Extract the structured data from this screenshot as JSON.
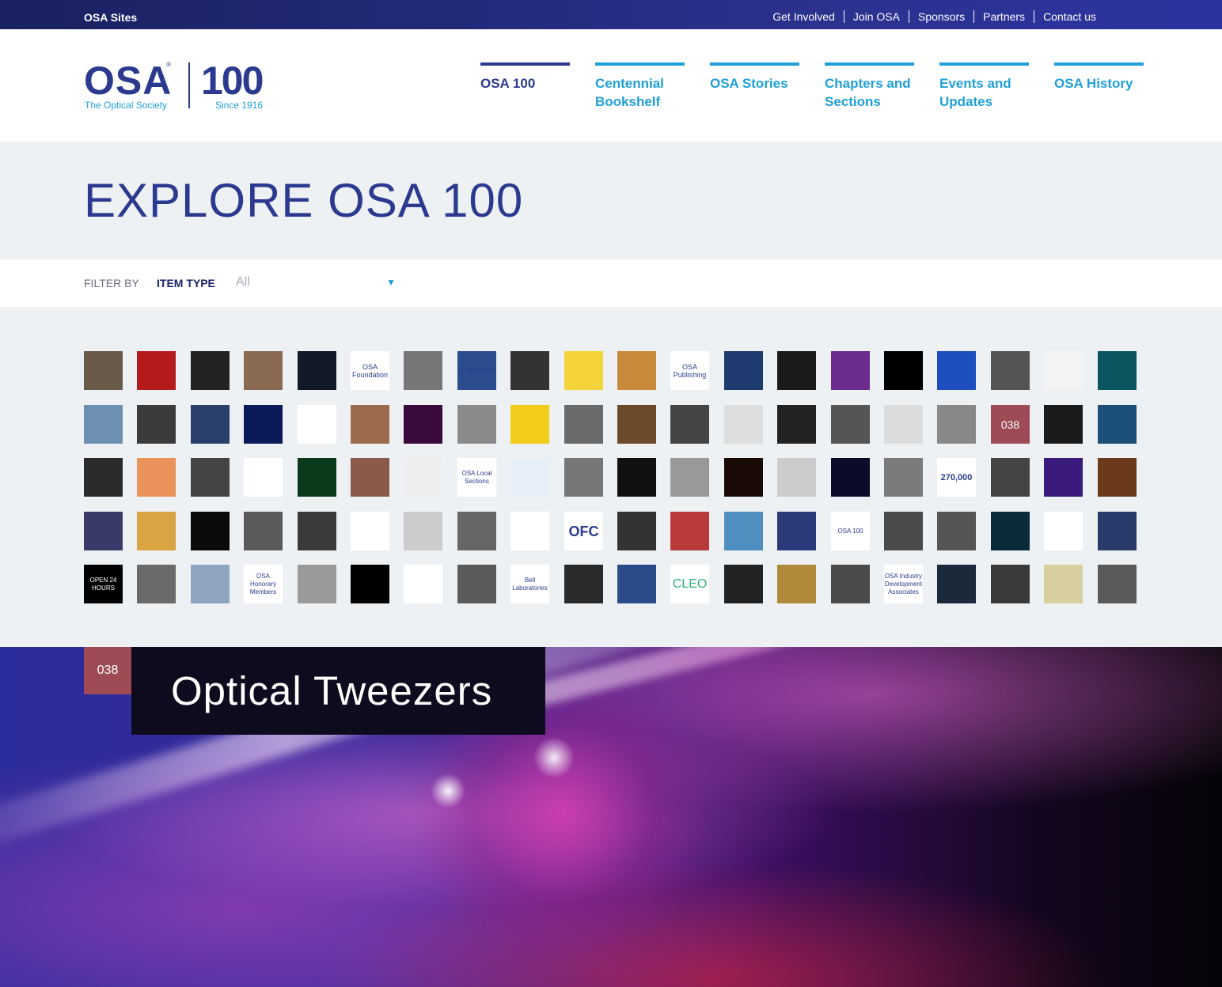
{
  "topbar": {
    "sites": "OSA Sites",
    "links": [
      "Get Involved",
      "Join OSA",
      "Sponsors",
      "Partners",
      "Contact us"
    ]
  },
  "logo": {
    "osa": "OSA",
    "osa_sub": "The Optical Society",
    "hundred": "100",
    "since": "Since 1916",
    "reg": "®"
  },
  "nav": {
    "items": [
      "OSA 100",
      "Centennial Bookshelf",
      "OSA Stories",
      "Chapters and Sections",
      "Events and Updates",
      "OSA History"
    ],
    "active": "OSA 100"
  },
  "page": {
    "title": "EXPLORE OSA 100"
  },
  "filter": {
    "label": "FILTER BY",
    "type": "ITEM TYPE",
    "value": "All",
    "arrow": "▼"
  },
  "tiles": [
    [
      "#6a5a4a",
      ""
    ],
    [
      "#b31b1b",
      ""
    ],
    [
      "#222222",
      ""
    ],
    [
      "#8a6a52",
      ""
    ],
    [
      "#111827",
      ""
    ],
    [
      "#ffffff",
      "OSA Foundation"
    ],
    [
      "#777777",
      ""
    ],
    [
      "#2b4d8f",
      "LASERFEST"
    ],
    [
      "#333333",
      ""
    ],
    [
      "#f4d33b",
      ""
    ],
    [
      "#c88a3a",
      ""
    ],
    [
      "#ffffff",
      "OSA Publishing"
    ],
    [
      "#1e3a6e",
      ""
    ],
    [
      "#1a1a1a",
      ""
    ],
    [
      "#6a2c8f",
      ""
    ],
    [
      "#000000",
      ""
    ],
    [
      "#1d4fbf",
      ""
    ],
    [
      "#555555",
      ""
    ],
    [
      "#f4f4f4",
      ""
    ],
    [
      "#0a5560",
      ""
    ],
    [
      "#6d8fb2",
      ""
    ],
    [
      "#3b3b3b",
      ""
    ],
    [
      "#2a3f6b",
      ""
    ],
    [
      "#0c1a5a",
      ""
    ],
    [
      "#ffffff",
      ""
    ],
    [
      "#9c6a4d",
      ""
    ],
    [
      "#3a0a3a",
      ""
    ],
    [
      "#8a8a8a",
      ""
    ],
    [
      "#f1cc1a",
      ""
    ],
    [
      "#6a6a6a",
      ""
    ],
    [
      "#6a4a2a",
      ""
    ],
    [
      "#444444",
      ""
    ],
    [
      "#dddddd",
      ""
    ],
    [
      "#222222",
      ""
    ],
    [
      "#555555",
      ""
    ],
    [
      "#dcdcdc",
      ""
    ],
    [
      "#888888",
      ""
    ],
    [
      "#9e4b56",
      "038"
    ],
    [
      "#1a1a1a",
      ""
    ],
    [
      "#1b4f7a",
      ""
    ],
    [
      "#2a2a2a",
      ""
    ],
    [
      "#e9925a",
      ""
    ],
    [
      "#444444",
      ""
    ],
    [
      "#ffffff",
      ""
    ],
    [
      "#0a3a1a",
      ""
    ],
    [
      "#8a5a4a",
      ""
    ],
    [
      "#eeeeee",
      ""
    ],
    [
      "#ffffff",
      "OSA Local Sections"
    ],
    [
      "#e6eef7",
      ""
    ],
    [
      "#777777",
      ""
    ],
    [
      "#111111",
      ""
    ],
    [
      "#999999",
      ""
    ],
    [
      "#1a0a05",
      ""
    ],
    [
      "#cccccc",
      ""
    ],
    [
      "#0c0c2a",
      ""
    ],
    [
      "#7a7a7a",
      ""
    ],
    [
      "#ffffff",
      "270,000"
    ],
    [
      "#444444",
      ""
    ],
    [
      "#3a1a7a",
      ""
    ],
    [
      "#6a3a1a",
      ""
    ],
    [
      "#3a3a6a",
      ""
    ],
    [
      "#d9a441",
      ""
    ],
    [
      "#0a0a0a",
      ""
    ],
    [
      "#5a5a5a",
      ""
    ],
    [
      "#3a3a3a",
      ""
    ],
    [
      "#ffffff",
      ""
    ],
    [
      "#cccccc",
      ""
    ],
    [
      "#666666",
      ""
    ],
    [
      "#ffffff",
      ""
    ],
    [
      "#ffffff",
      "OFC"
    ],
    [
      "#333333",
      ""
    ],
    [
      "#b83a3a",
      ""
    ],
    [
      "#4f8fc0",
      ""
    ],
    [
      "#2a3a7a",
      ""
    ],
    [
      "#ffffff",
      "OSA 100"
    ],
    [
      "#4a4a4a",
      ""
    ],
    [
      "#555555",
      ""
    ],
    [
      "#0a2a3a",
      ""
    ],
    [
      "#ffffff",
      ""
    ],
    [
      "#2a3a6a",
      ""
    ],
    [
      "#000000",
      "OPEN 24 HOURS"
    ],
    [
      "#6a6a6a",
      ""
    ],
    [
      "#8fa5bf",
      ""
    ],
    [
      "#ffffff",
      "OSA Honorary Members"
    ],
    [
      "#9a9a9a",
      ""
    ],
    [
      "#000000",
      ""
    ],
    [
      "#ffffff",
      ""
    ],
    [
      "#5a5a5a",
      ""
    ],
    [
      "#ffffff",
      "Bell Laboratories"
    ],
    [
      "#2a2a2a",
      ""
    ],
    [
      "#2a4a8a",
      ""
    ],
    [
      "#ffffff",
      "CLEO"
    ],
    [
      "#222222",
      ""
    ],
    [
      "#b08a3a",
      ""
    ],
    [
      "#4a4a4a",
      ""
    ],
    [
      "#ffffff",
      "OSA Industry Development Associates"
    ],
    [
      "#1a2a3a",
      ""
    ],
    [
      "#3a3a3a",
      ""
    ],
    [
      "#d8cf9e",
      ""
    ],
    [
      "#5a5a5a",
      ""
    ]
  ],
  "feature": {
    "number": "038",
    "title": "Optical Tweezers"
  }
}
